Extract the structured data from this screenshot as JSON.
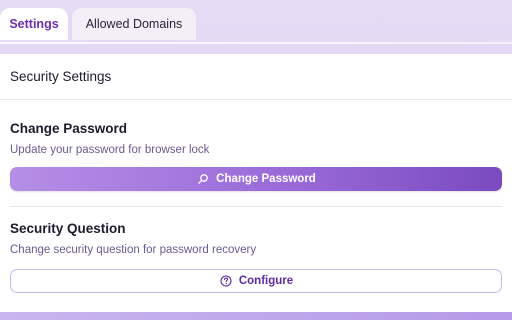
{
  "tabs": [
    {
      "label": "Settings"
    },
    {
      "label": "Allowed Domains"
    }
  ],
  "panel": {
    "title": "Security Settings",
    "sections": [
      {
        "title": "Change Password",
        "description": "Update your password for browser lock",
        "button_label": "Change Password",
        "button_icon": "search-icon"
      },
      {
        "title": "Security Question",
        "description": "Change security question for password recovery",
        "button_label": "Configure",
        "button_icon": "help-circle-icon"
      }
    ]
  },
  "colors": {
    "accent": "#7a4bbf",
    "active_tab_text": "#6b2fb3",
    "description_text": "#6b5a8f",
    "outline_border": "#cbb8ee"
  }
}
